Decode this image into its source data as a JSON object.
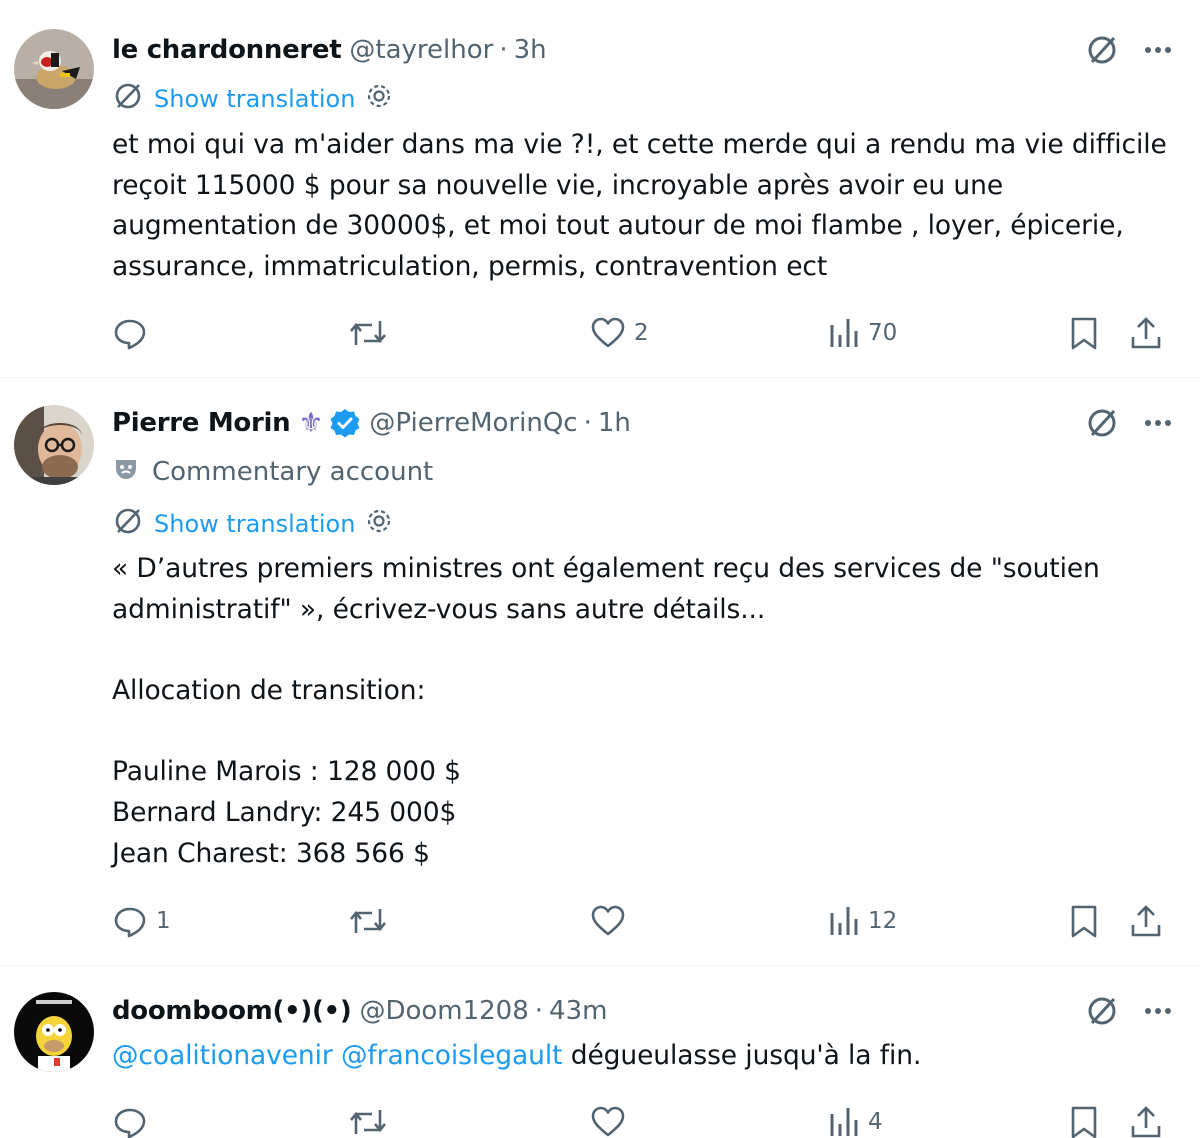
{
  "tweets": [
    {
      "display_name": "le chardonneret",
      "handle": "@tayrelhor",
      "separator": "·",
      "time": "3h",
      "translation_label": "Show translation",
      "body": "et moi qui va m'aider dans ma vie ?!, et cette merde qui a rendu ma vie difficile reçoit 115000 $ pour sa nouvelle vie, incroyable après avoir eu une augmentation de 30000$, et moi tout autour de moi flambe , loyer, épicerie, assurance, immatriculation, permis, contravention ect",
      "replies": "",
      "reposts": "",
      "likes": "2",
      "views": "70"
    },
    {
      "display_name": "Pierre Morin",
      "flag": "⚜",
      "handle": "@PierreMorinQc",
      "separator": "·",
      "time": "1h",
      "commentary_label": "Commentary account",
      "translation_label": "Show translation",
      "body_lines": [
        "« D’autres premiers ministres ont également reçu des services de \"soutien administratif\" », écrivez-vous sans autre détails...",
        "",
        "Allocation de transition:",
        "",
        "Pauline Marois : 128 000 $",
        "Bernard Landry: 245 000$",
        "Jean Charest: 368 566 $"
      ],
      "replies": "1",
      "reposts": "",
      "likes": "",
      "views": "12"
    },
    {
      "display_name": "doomboom(•)(•)",
      "handle": "@Doom1208",
      "separator": "·",
      "time": "43m",
      "mention_1": "@coalitionavenir",
      "mention_2": "@francoislegault",
      "body_rest": " dégueulasse jusqu'à la fin.",
      "replies": "",
      "reposts": "",
      "likes": "",
      "views": "4"
    }
  ],
  "icons": {
    "reply": "reply-icon",
    "repost": "repost-icon",
    "like": "heart-icon",
    "views": "views-icon",
    "bookmark": "bookmark-icon",
    "share": "share-icon",
    "grok": "grok-icon",
    "more": "more-icon",
    "translate": "translate-icon",
    "gear": "gear-icon",
    "verified": "verified-badge-icon",
    "commentary": "mask-icon"
  },
  "colors": {
    "text": "#0f1419",
    "secondary": "#536471",
    "accent": "#1d9bf0",
    "divider": "#eff3f4"
  }
}
